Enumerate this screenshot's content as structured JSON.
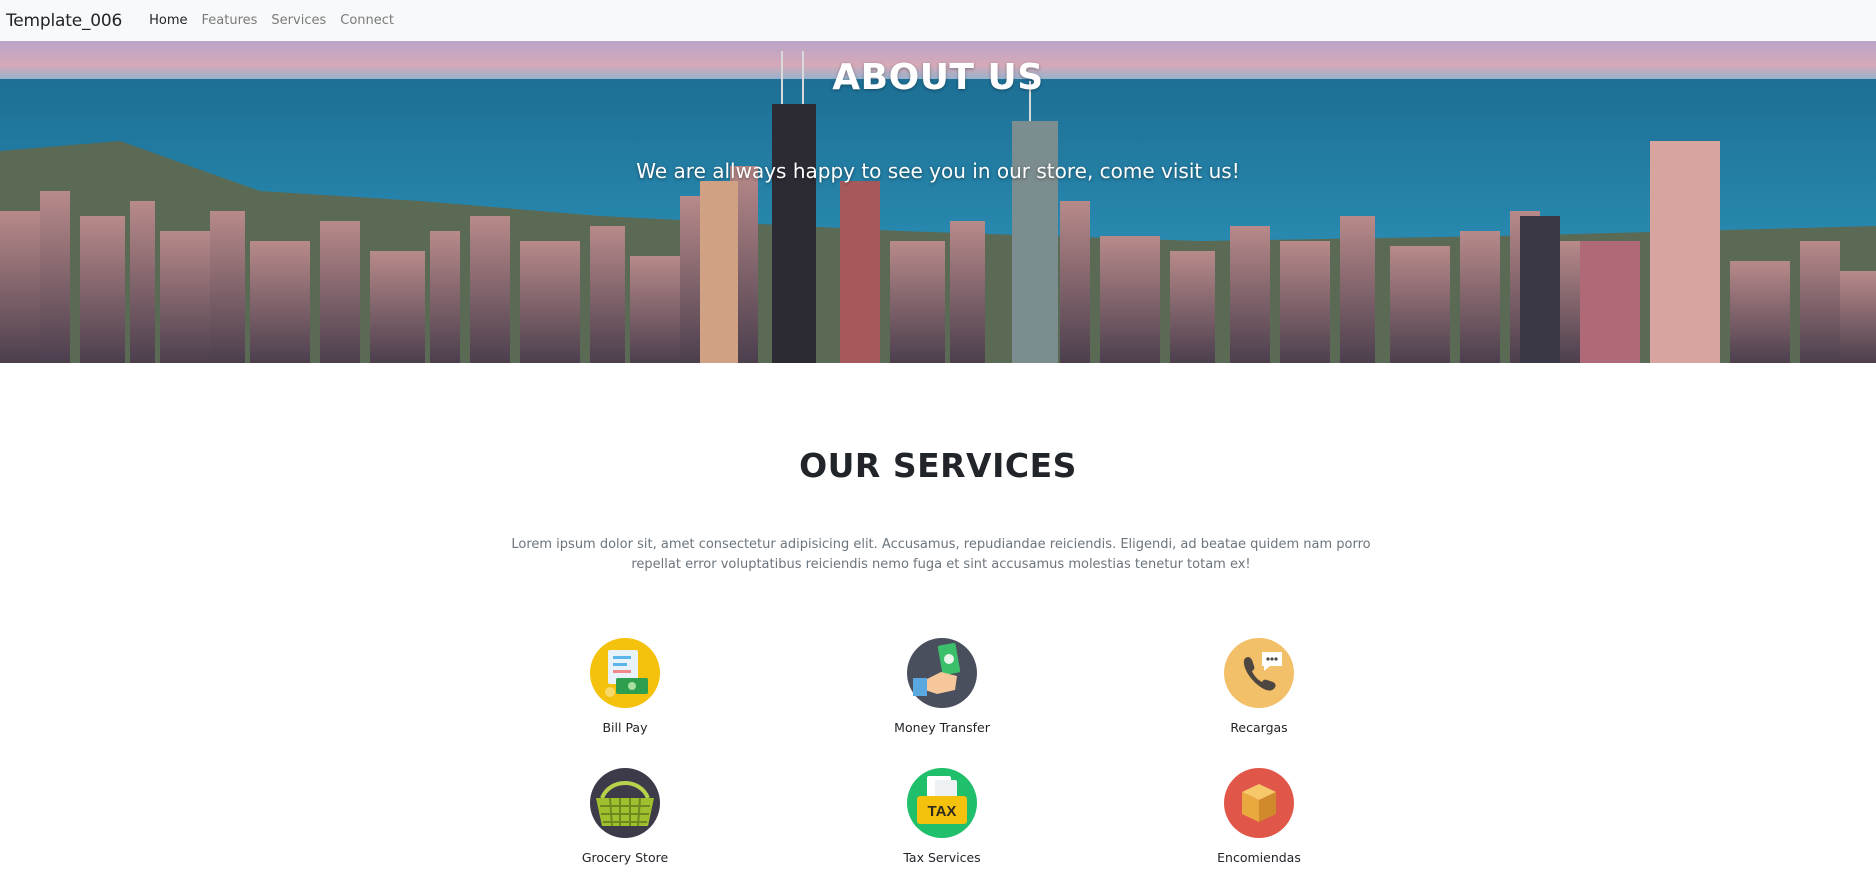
{
  "navbar": {
    "brand": "Template_006",
    "links": [
      "Home",
      "Features",
      "Services",
      "Connect"
    ]
  },
  "hero": {
    "title": "ABOUT US",
    "subtitle": "We are allways happy to see you in our store, come visit us!"
  },
  "services": {
    "title": "OUR SERVICES",
    "description": "Lorem ipsum dolor sit, amet consectetur adipisicing elit. Accusamus, repudiandae reiciendis. Eligendi, ad beatae quidem nam porro repellat error voluptatibus reiciendis nemo fuga et sint accusamus molestias tenetur totam ex!",
    "items": [
      {
        "label": "Bill Pay",
        "icon": "bill-pay-icon"
      },
      {
        "label": "Money Transfer",
        "icon": "money-transfer-icon"
      },
      {
        "label": "Recargas",
        "icon": "phone-icon"
      },
      {
        "label": "Grocery Store",
        "icon": "basket-icon"
      },
      {
        "label": "Tax Services",
        "icon": "tax-icon"
      },
      {
        "label": "Encomiendas",
        "icon": "package-icon"
      }
    ],
    "tax_icon_text": "TAX"
  },
  "colors": {
    "navbar_bg": "#f8f9fa",
    "bill_pay": "#f4c20d",
    "money_transfer": "#4a4f5e",
    "recargas": "#f2c069",
    "grocery": "#3d3a4a",
    "tax": "#1fbf6b",
    "encomiendas": "#e0574a"
  }
}
